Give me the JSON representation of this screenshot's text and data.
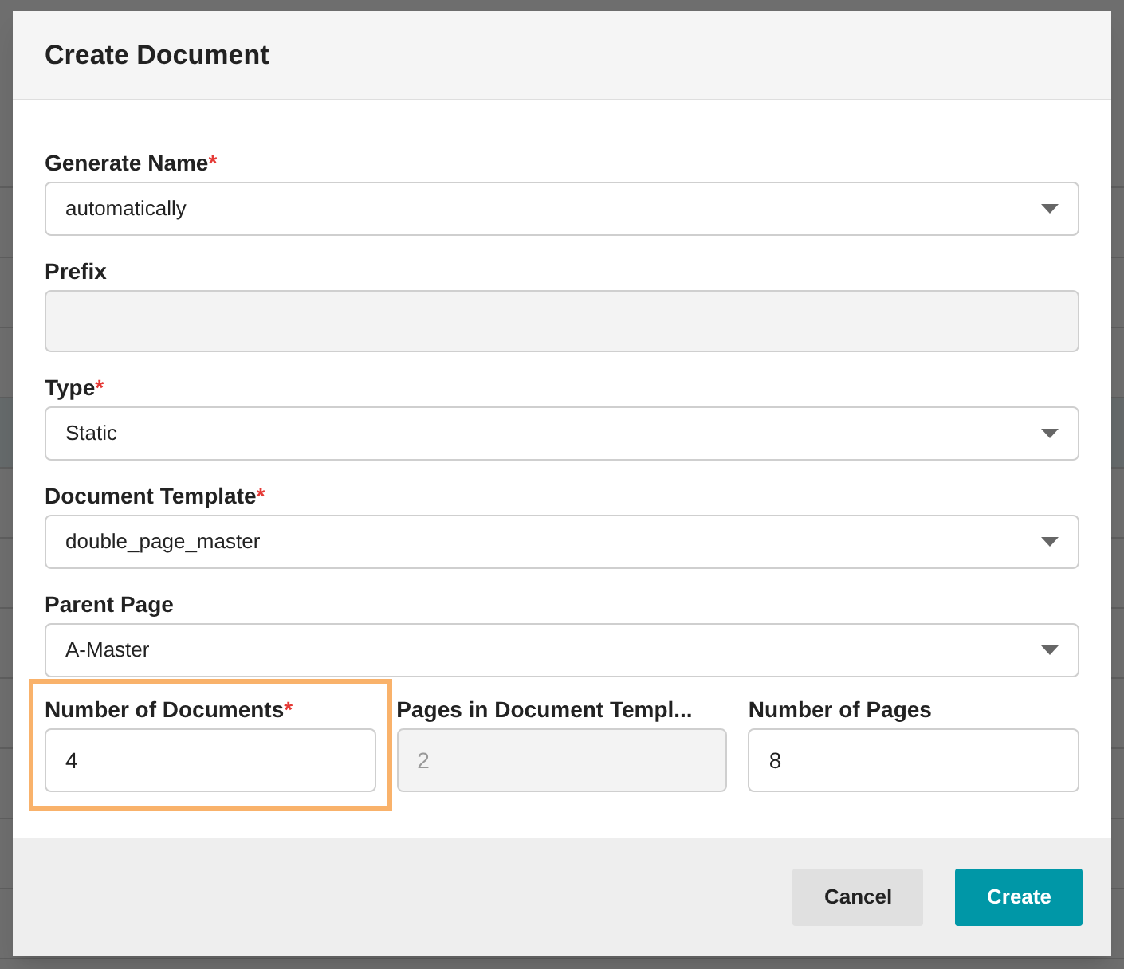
{
  "dialog": {
    "title": "Create Document",
    "fields": [
      {
        "label": "Generate Name",
        "required_mark": "*",
        "kind": "select",
        "value": "automatically",
        "disabled": false
      },
      {
        "label": "Prefix",
        "kind": "text",
        "disabled": true
      },
      {
        "label": "Type",
        "required_mark": "*",
        "kind": "select",
        "value": "Static",
        "disabled": false
      },
      {
        "label": "Document Template",
        "required_mark": "*",
        "kind": "select",
        "value": "double_page_master",
        "disabled": false
      },
      {
        "label": "Parent Page",
        "kind": "select",
        "value": "A-Master",
        "disabled": false
      }
    ],
    "field_row": [
      {
        "label": "Number of Documents",
        "required_mark": "*",
        "kind": "text",
        "value": "4",
        "disabled": false,
        "highlighted": true
      },
      {
        "label": "Pages in Document Templ...",
        "kind": "text",
        "value": "2",
        "disabled": true,
        "highlighted": false
      },
      {
        "label": "Number of Pages",
        "kind": "text",
        "value": "8",
        "disabled": false,
        "highlighted": false
      }
    ],
    "buttons": [
      {
        "label": "Cancel",
        "kind": "secondary"
      },
      {
        "label": "Create",
        "kind": "primary"
      }
    ]
  }
}
